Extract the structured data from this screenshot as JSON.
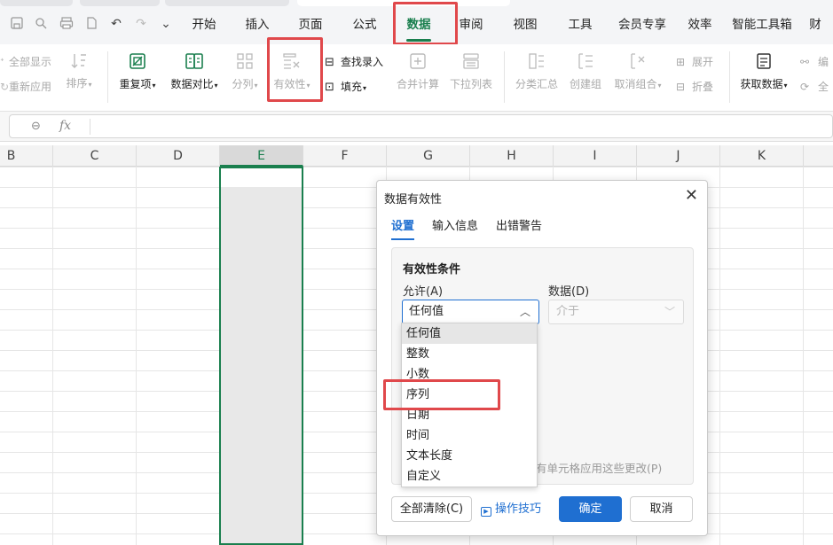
{
  "menubar": {
    "tabs": [
      "开始",
      "插入",
      "页面",
      "公式",
      "数据",
      "审阅",
      "视图",
      "工具",
      "会员专享",
      "效率",
      "智能工具箱",
      "财"
    ],
    "active_tab": "数据"
  },
  "ribbon": {
    "show_all": "全部显示",
    "reapply": "重新应用",
    "sort": "排序",
    "duplicates": "重复项",
    "compare": "数据对比",
    "split": "分列",
    "validation": "有效性",
    "find_entry": "查找录入",
    "fill": "填充",
    "consolidate": "合并计算",
    "dropdown_list": "下拉列表",
    "subtotal": "分类汇总",
    "group": "创建组",
    "ungroup": "取消组合",
    "expand": "展开",
    "collapse": "折叠",
    "get_data": "获取数据",
    "edit_partial": "编",
    "all_partial": "全"
  },
  "formula_bar": {
    "fx": "fx"
  },
  "columns": [
    "B",
    "C",
    "D",
    "E",
    "F",
    "G",
    "H",
    "I",
    "J",
    "K"
  ],
  "selected_column": "E",
  "dialog": {
    "title": "数据有效性",
    "tabs": [
      "设置",
      "输入信息",
      "出错警告"
    ],
    "active_tab": "设置",
    "panel_title": "有效性条件",
    "allow_label": "允许(A)",
    "data_label": "数据(D)",
    "allow_value": "任何值",
    "data_value": "介于",
    "allow_options": [
      "任何值",
      "整数",
      "小数",
      "序列",
      "日期",
      "时间",
      "文本长度",
      "自定义"
    ],
    "highlighted_option": "序列",
    "apply_note": "有单元格应用这些更改(P)",
    "buttons": {
      "clear": "全部清除(C)",
      "tips": "操作技巧",
      "ok": "确定",
      "cancel": "取消"
    }
  },
  "colors": {
    "accent_green": "#1a7f4e",
    "accent_blue": "#1f6fd1",
    "highlight_red": "#e0484b"
  }
}
